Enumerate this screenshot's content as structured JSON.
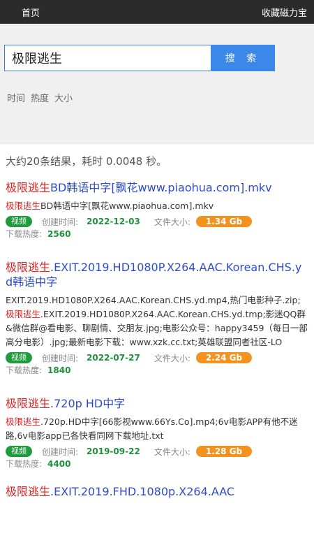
{
  "nav": {
    "home": "首页",
    "bookmark": "收藏磁力宝"
  },
  "search": {
    "query": "极限逃生",
    "button": "搜 索"
  },
  "sort": [
    "时间",
    "热度",
    "大小"
  ],
  "summary": "大约20条结果，耗时 0.0048 秒。",
  "labels": {
    "created": "创建时间:",
    "size": "文件大小:",
    "heat": "下载热度:"
  },
  "results": [
    {
      "title_hl": "极限逃生",
      "title_rest": "BD韩语中字[飘花www.piaohua.com].mkv",
      "desc_parts": [
        [
          "hl",
          "极限逃生"
        ],
        [
          "t",
          "BD韩语中字[飘花www.piaohua.com].mkv"
        ]
      ],
      "tag": "视频",
      "date": "2022-12-03",
      "size": "1.34 Gb",
      "heat": "2560"
    },
    {
      "title_hl": "极限逃生",
      "title_rest": ".EXIT.2019.HD1080P.X264.AAC.Korean.CHS.yd韩语中字",
      "desc_parts": [
        [
          "t",
          "EXIT.2019.HD1080P.X264.AAC.Korean.CHS.yd.mp4,热门电影种子.zip;"
        ],
        [
          "hl",
          "极限逃生"
        ],
        [
          "t",
          ".EXIT.2019.HD1080P.X264.AAC.Korean.CHS.yd.tmp;影迷QQ群&微信群@看电影、聊剧情、交朋友.jpg;电影公众号：happy3459（每日一部高分电影）.jpg;最新电影下载：www.xzk.cc.txt;英雄联盟同者社区-LO"
        ]
      ],
      "tag": "视频",
      "date": "2022-07-27",
      "size": "2.24 Gb",
      "heat": "1840"
    },
    {
      "title_hl": "极限逃生",
      "title_rest": ".720p HD中字",
      "desc_parts": [
        [
          "hl",
          "极限逃生"
        ],
        [
          "t",
          ".720p.HD中字[66影视www.66Ys.Co].mp4;6v电影APP有他不迷路,6v电影app已各快看同网下载地址.txt"
        ]
      ],
      "tag": "视频",
      "date": "2019-09-22",
      "size": "1.28 Gb",
      "heat": "4400"
    },
    {
      "title_hl": "极限逃生",
      "title_rest": ".EXIT.2019.FHD.1080p.X264.AAC"
    }
  ]
}
